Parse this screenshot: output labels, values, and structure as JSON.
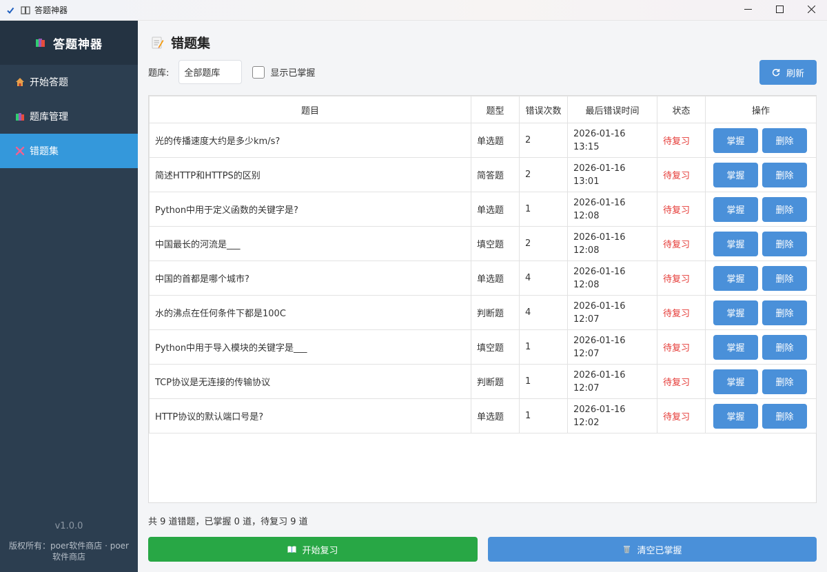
{
  "window": {
    "title": "答题神器",
    "icons": {
      "check": "check-icon",
      "app": "book-icon",
      "min": "minimize-icon",
      "max": "maximize-icon",
      "close": "close-icon"
    }
  },
  "sidebar": {
    "app_name": "答题神器",
    "items": [
      {
        "label": "开始答题",
        "icon": "house-icon",
        "active": false
      },
      {
        "label": "题库管理",
        "icon": "books-icon",
        "active": false
      },
      {
        "label": "错题集",
        "icon": "cross-icon",
        "active": true
      }
    ],
    "version": "v1.0.0",
    "copyright": "版权所有：poer软件商店 · poer软件商店"
  },
  "page": {
    "title": "错题集",
    "icon": "memo-icon",
    "filter_label": "题库:",
    "bank_select": "全部题库",
    "show_mastered_label": "显示已掌握",
    "show_mastered": false,
    "refresh_label": "刷新"
  },
  "table": {
    "columns": [
      "题目",
      "题型",
      "错误次数",
      "最后错误时间",
      "状态",
      "操作"
    ],
    "rows": [
      {
        "question": "光的传播速度大约是多少km/s?",
        "type": "单选题",
        "errors": "2",
        "date": "2026-01-16",
        "time": "13:15",
        "status": "待复习"
      },
      {
        "question": "简述HTTP和HTTPS的区别",
        "type": "简答题",
        "errors": "2",
        "date": "2026-01-16",
        "time": "13:01",
        "status": "待复习"
      },
      {
        "question": "Python中用于定义函数的关键字是?",
        "type": "单选题",
        "errors": "1",
        "date": "2026-01-16",
        "time": "12:08",
        "status": "待复习"
      },
      {
        "question": "中国最长的河流是___",
        "type": "填空题",
        "errors": "2",
        "date": "2026-01-16",
        "time": "12:08",
        "status": "待复习"
      },
      {
        "question": "中国的首都是哪个城市?",
        "type": "单选题",
        "errors": "4",
        "date": "2026-01-16",
        "time": "12:08",
        "status": "待复习"
      },
      {
        "question": "水的沸点在任何条件下都是100C",
        "type": "判断题",
        "errors": "4",
        "date": "2026-01-16",
        "time": "12:07",
        "status": "待复习"
      },
      {
        "question": "Python中用于导入模块的关键字是___",
        "type": "填空题",
        "errors": "1",
        "date": "2026-01-16",
        "time": "12:07",
        "status": "待复习"
      },
      {
        "question": "TCP协议是无连接的传输协议",
        "type": "判断题",
        "errors": "1",
        "date": "2026-01-16",
        "time": "12:07",
        "status": "待复习"
      },
      {
        "question": "HTTP协议的默认端口号是?",
        "type": "单选题",
        "errors": "1",
        "date": "2026-01-16",
        "time": "12:02",
        "status": "待复习"
      }
    ],
    "master_label": "掌握",
    "delete_label": "删除"
  },
  "summary": "共 9 道错题，已掌握 0 道，待复习 9 道",
  "actions": {
    "start_review": "开始复习",
    "clear_mastered": "清空已掌握"
  },
  "colors": {
    "sidebar_bg": "#2c3e50",
    "sidebar_active": "#3498db",
    "primary_button": "#4a90d9",
    "start_button": "#28a745",
    "status_pending": "#e53935"
  }
}
